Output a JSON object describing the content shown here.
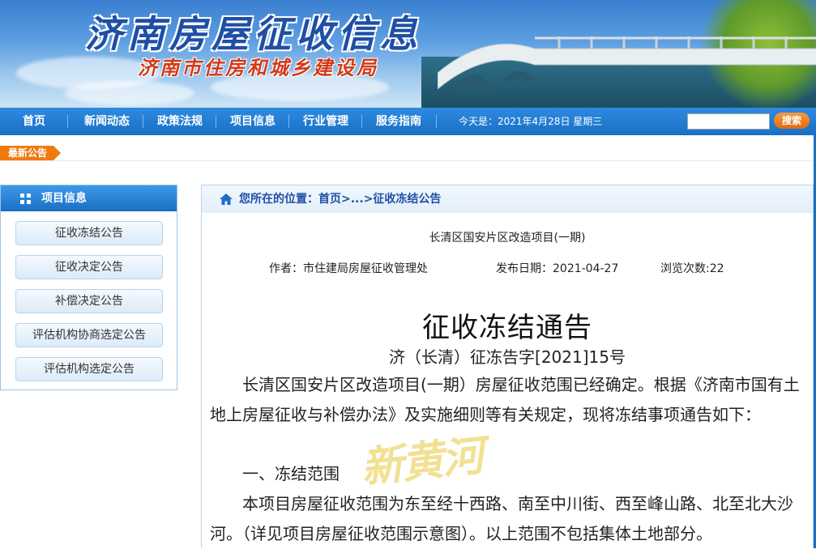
{
  "banner": {
    "title": "济南房屋征收信息",
    "subtitle": "济南市住房和城乡建设局"
  },
  "nav": {
    "items": [
      {
        "label": "首页"
      },
      {
        "label": "新闻动态"
      },
      {
        "label": "政策法规"
      },
      {
        "label": "项目信息"
      },
      {
        "label": "行业管理"
      },
      {
        "label": "服务指南"
      }
    ],
    "date_text": "今天是：2021年4月28日 星期三",
    "search_button": "搜索",
    "search_value": ""
  },
  "latest_label": "最新公告",
  "sidebar": {
    "title": "项目信息",
    "items": [
      {
        "label": "征收冻结公告"
      },
      {
        "label": "征收决定公告"
      },
      {
        "label": "补偿决定公告"
      },
      {
        "label": "评估机构协商选定公告"
      },
      {
        "label": "评估机构选定公告"
      }
    ]
  },
  "breadcrumb": {
    "prefix": "您所在的位置：",
    "home": "首页",
    "sep": ">...>",
    "current": "征收冻结公告"
  },
  "article": {
    "project": "长清区国安片区改造项目(一期)",
    "author": "作者：市住建局房屋征收管理处",
    "date": "发布日期：2021-04-27",
    "views": "浏览次数:22",
    "title": "征收冻结通告",
    "doc_no": "济（长清）征冻告字[2021]15号",
    "paragraphs": [
      "长清区国安片区改造项目(一期）房屋征收范围已经确定。根据《济南市国有土地上房屋征收与补偿办法》及实施细则等有关规定，现将冻结事项通告如下：",
      "一、冻结范围",
      "本项目房屋征收范围为东至经十西路、南至中川街、西至峰山路、北至北大沙河。（详见项目房屋征收范围示意图）。以上范围不包括集体土地部分。"
    ]
  },
  "watermark": "新黄河",
  "colors": {
    "nav_blue": "#1a6fc4",
    "title_blue": "#1f4fa5",
    "subtitle_red": "#d23a1a",
    "accent_orange": "#f07a10"
  }
}
